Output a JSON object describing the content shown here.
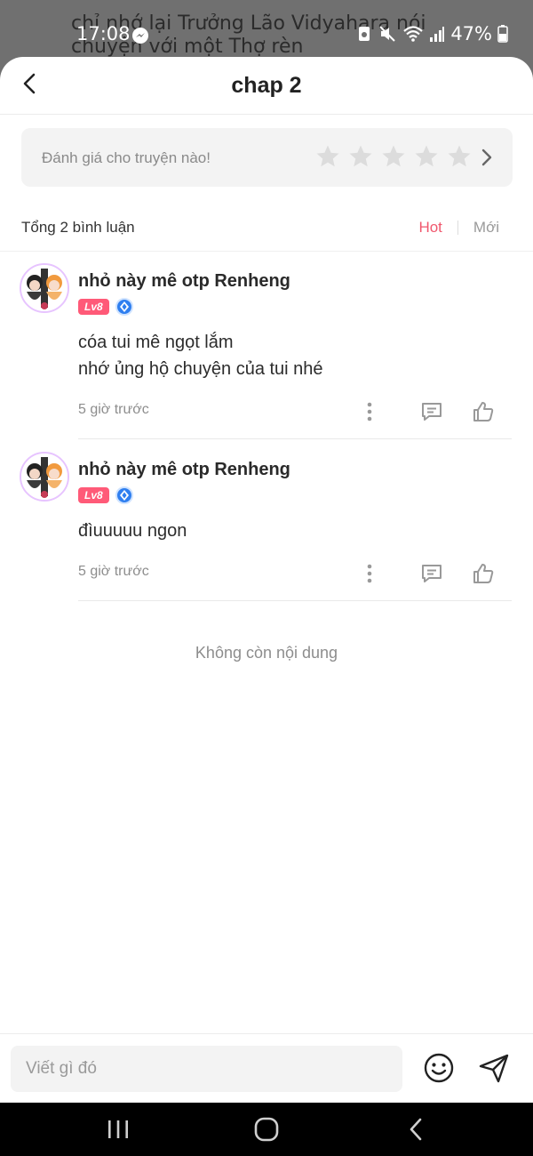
{
  "background": {
    "text": "chỉ nhớ lại Trưởng Lão Vidyahara nói chuyện với một Thợ rèn"
  },
  "status_bar": {
    "time": "17:08",
    "battery": "47%",
    "icons": [
      "messenger-icon",
      "recycle-icon",
      "mute-icon",
      "wifi-icon",
      "signal-icon",
      "battery-icon"
    ]
  },
  "header": {
    "title": "chap 2",
    "back_icon": "chevron-left-icon"
  },
  "rating": {
    "prompt": "Đánh giá cho truyện nào!",
    "stars_total": 5,
    "stars_filled": 0,
    "star_color": "#dcdcdc"
  },
  "comments_section": {
    "count_label": "Tổng 2 bình luận",
    "sort_hot": "Hot",
    "sort_new": "Mới",
    "active_color": "#f0576d"
  },
  "comments": [
    {
      "username": "nhỏ này mê otp Renheng",
      "level": "Lv8",
      "lines": [
        "cóa tui mê ngọt lắm",
        "nhớ ủng hộ chuyện của tui nhé"
      ],
      "time": "5 giờ trước"
    },
    {
      "username": "nhỏ này mê otp Renheng",
      "level": "Lv8",
      "lines": [
        "đìuuuuu ngon"
      ],
      "time": "5 giờ trước"
    }
  ],
  "end_message": "Không còn nội dung",
  "composer": {
    "placeholder": "Viết gì đó"
  },
  "colors": {
    "accent": "#f0576d",
    "level_badge": "#ff5a78",
    "diamond_badge": "#2f7ff0"
  }
}
